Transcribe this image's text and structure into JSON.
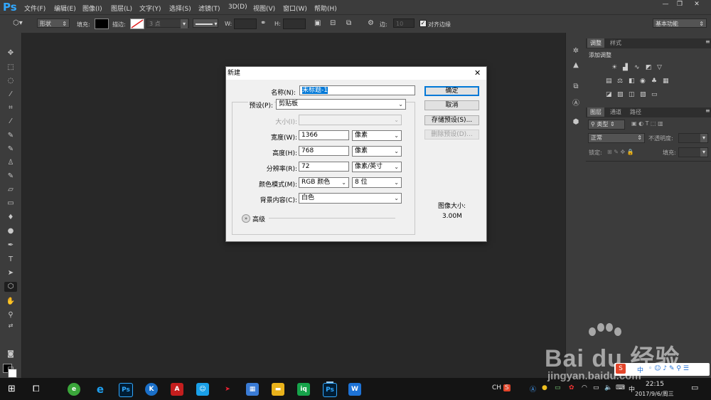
{
  "app": {
    "logo": "Ps",
    "accent": "#31a8ff"
  },
  "menubar": {
    "items": [
      "文件(F)",
      "编辑(E)",
      "图像(I)",
      "图层(L)",
      "文字(Y)",
      "选择(S)",
      "滤镜(T)",
      "3D(D)",
      "视图(V)",
      "窗口(W)",
      "帮助(H)"
    ]
  },
  "options_bar": {
    "mode": "形状",
    "fill_label": "填充:",
    "stroke_label": "描边:",
    "stroke_size": "3 点",
    "w_label": "W:",
    "h_label": "H:",
    "edge_label": "边:",
    "edge_value": "10",
    "align_edges": "对齐边缘",
    "workspace": "基本功能"
  },
  "right_panel": {
    "tab_adjust": "调整",
    "tab_style": "样式",
    "add_adjust": "添加调整",
    "tab_layers": "图层",
    "tab_channels": "通道",
    "tab_paths": "路径",
    "kind": "类型",
    "blend": "正常",
    "opacity_label": "不透明度:",
    "lock_label": "锁定:",
    "fill_label": "填充:"
  },
  "dialog": {
    "title": "新建",
    "name_label": "名称(N):",
    "name_value": "未标题-1",
    "preset_label": "预设(P):",
    "preset_value": "剪贴板",
    "size_label": "大小(I):",
    "width_label": "宽度(W):",
    "width_value": "1366",
    "width_unit": "像素",
    "height_label": "高度(H):",
    "height_value": "768",
    "height_unit": "像素",
    "res_label": "分辨率(R):",
    "res_value": "72",
    "res_unit": "像素/英寸",
    "color_label": "颜色模式(M):",
    "color_value": "RGB 颜色",
    "bit_value": "8 位",
    "bg_label": "背景内容(C):",
    "bg_value": "白色",
    "advanced": "高级",
    "ok": "确定",
    "cancel": "取消",
    "save_preset": "存储预设(S)...",
    "delete_preset": "删除预设(D)...",
    "image_size_label": "图像大小:",
    "image_size_value": "3.00M"
  },
  "taskbar": {
    "ime": "中",
    "ime_en": "CH",
    "time": "22:15",
    "date": "2017/9/6/周三"
  },
  "watermark": {
    "brand": "Bai du 经验",
    "url": "jingyan.baidu.com"
  }
}
